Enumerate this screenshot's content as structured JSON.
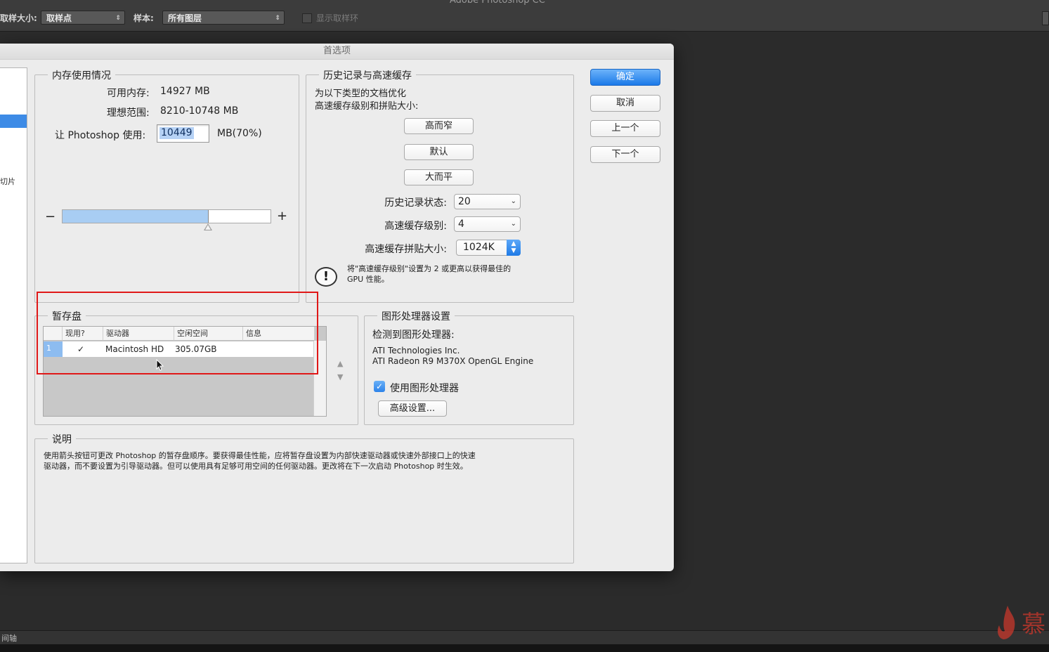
{
  "app": {
    "title": "Adobe Photoshop CC"
  },
  "options_bar": {
    "sample_size_label": "取样大小:",
    "sample_size_value": "取样点",
    "sample_label": "样本:",
    "sample_value": "所有图层",
    "show_ring_label": "显示取样环"
  },
  "dialog": {
    "title": "首选项",
    "sidebar_partial_label": "切片",
    "memory": {
      "title": "内存使用情况",
      "available_label": "可用内存:",
      "available_value": "14927 MB",
      "ideal_label": "理想范围:",
      "ideal_value": "8210-10748 MB",
      "use_label": "让 Photoshop 使用:",
      "use_value": "10449",
      "use_suffix": "MB(70%)",
      "slider_percent": 70,
      "minus": "−",
      "plus": "+"
    },
    "history_cache": {
      "title": "历史记录与高速缓存",
      "desc_line1": "为以下类型的文档优化",
      "desc_line2": "高速缓存级别和拼贴大小:",
      "btn_tall_thin": "高而窄",
      "btn_default": "默认",
      "btn_big_flat": "大而平",
      "history_states_label": "历史记录状态:",
      "history_states_value": "20",
      "cache_levels_label": "高速缓存级别:",
      "cache_levels_value": "4",
      "cache_tile_label": "高速缓存拼贴大小:",
      "cache_tile_value": "1024K",
      "tip_line1": "将\"高速缓存级别\"设置为 2 或更高以获得最佳的",
      "tip_line2": "GPU 性能。"
    },
    "scratch": {
      "title": "暂存盘",
      "col_active": "现用?",
      "col_drive": "驱动器",
      "col_free": "空闲空间",
      "col_info": "信息",
      "row_num": "1",
      "row_check": "✓",
      "row_drive": "Macintosh HD",
      "row_free": "305.07GB"
    },
    "gpu": {
      "title": "图形处理器设置",
      "detected_label": "检测到图形处理器:",
      "vendor": "ATI Technologies Inc.",
      "model": "ATI Radeon R9 M370X OpenGL Engine",
      "use_gpu_label": "使用图形处理器",
      "advanced_button": "高级设置..."
    },
    "description": {
      "title": "说明",
      "line1": "使用箭头按钮可更改 Photoshop 的暂存盘顺序。要获得最佳性能，应将暂存盘设置为内部快速驱动器或快速外部接口上的快速",
      "line2": "驱动器，而不要设置为引导驱动器。但可以使用具有足够可用空间的任何驱动器。更改将在下一次启动 Photoshop 时生效。"
    },
    "buttons": {
      "ok": "确定",
      "cancel": "取消",
      "prev": "上一个",
      "next": "下一个"
    }
  },
  "bottom": {
    "label": "间轴"
  },
  "watermark": {
    "text": "慕"
  },
  "colors": {
    "accent": "#1b79e8",
    "annotation_red": "#e01818"
  }
}
